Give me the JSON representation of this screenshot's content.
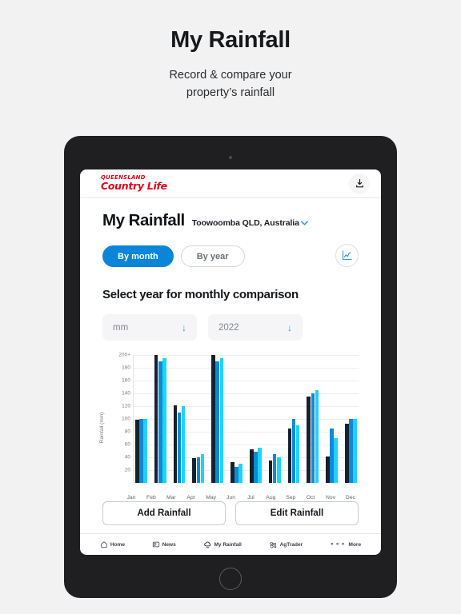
{
  "promo": {
    "title": "My Rainfall",
    "subtitle_line1": "Record & compare your",
    "subtitle_line2": "property’s rainfall"
  },
  "app": {
    "logo_top": "QUEENSLAND",
    "logo_bottom": "Country Life",
    "download_icon": "download-icon",
    "brand_color": "#e2001a",
    "accent_color": "#0a85d8"
  },
  "page": {
    "title": "My Rainfall",
    "location": "Toowoomba QLD, Australia",
    "location_chevron": "⌄"
  },
  "toggles": {
    "by_month": "By month",
    "by_year": "By year",
    "chart_icon": "line-chart-icon"
  },
  "section": {
    "title": "Select year for monthly comparison",
    "unit_select": {
      "value": "mm",
      "arrow": "↓"
    },
    "year_select": {
      "value": "2022",
      "arrow": "↓"
    }
  },
  "actions": {
    "add": "Add Rainfall",
    "edit": "Edit Rainfall"
  },
  "tabbar": {
    "items": [
      {
        "label": "Home",
        "icon": "home-icon"
      },
      {
        "label": "News",
        "icon": "news-icon"
      },
      {
        "label": "My Rainfall",
        "icon": "rain-cloud-icon"
      },
      {
        "label": "AgTrader",
        "icon": "tractor-icon"
      },
      {
        "label": "More",
        "icon": "more-dots-icon"
      }
    ]
  },
  "chart_data": {
    "type": "bar",
    "title": "",
    "xlabel": "",
    "ylabel": "Rainfall (mm)",
    "categories": [
      "Jan",
      "Feb",
      "Mar",
      "Apr",
      "May",
      "Jun",
      "Jul",
      "Aug",
      "Sep",
      "Oct",
      "Nov",
      "Dec"
    ],
    "ylim": [
      0,
      200
    ],
    "yticks": [
      20,
      40,
      60,
      80,
      100,
      120,
      140,
      160,
      180,
      200
    ],
    "yticklabels": [
      "20",
      "40",
      "60",
      "80",
      "100",
      "120",
      "140",
      "160",
      "180",
      "200+"
    ],
    "grid": true,
    "legend": "none",
    "series": [
      {
        "name": "series-1",
        "color": "#16202e",
        "values": [
          99,
          200,
          121,
          39,
          200,
          33,
          53,
          35,
          85,
          135,
          41,
          93
        ]
      },
      {
        "name": "series-2",
        "color": "#0d8ad6",
        "values": [
          100,
          190,
          110,
          40,
          190,
          25,
          49,
          45,
          100,
          140,
          85,
          100
        ]
      },
      {
        "name": "series-3",
        "color": "#1fd3f5",
        "values": [
          100,
          195,
          120,
          45,
          195,
          30,
          55,
          40,
          90,
          145,
          70,
          100
        ]
      }
    ]
  }
}
